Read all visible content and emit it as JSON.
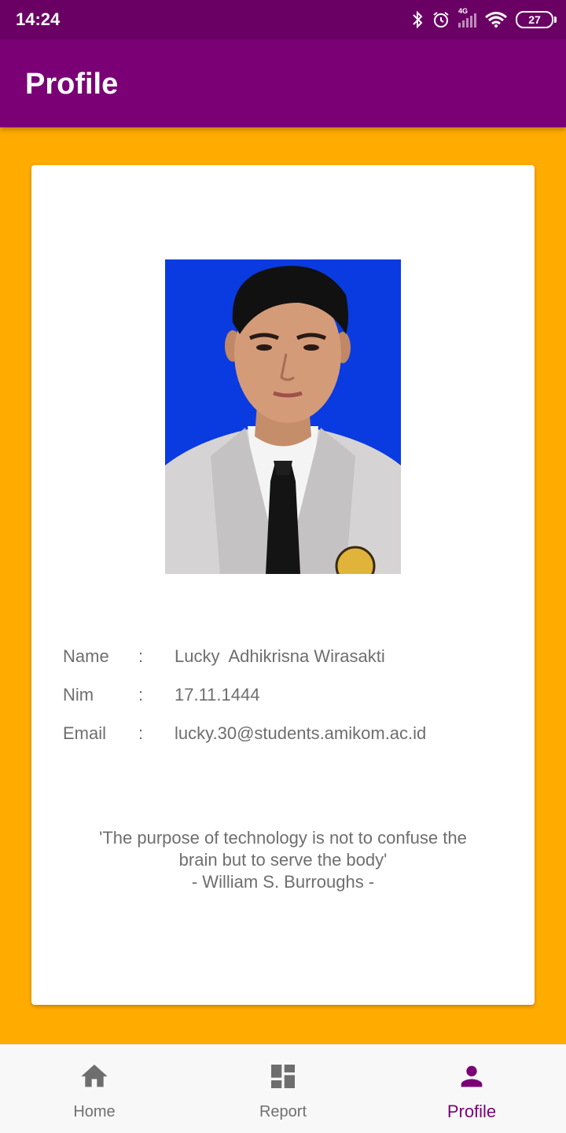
{
  "status_bar": {
    "time": "14:24",
    "network": "4G",
    "battery": "27"
  },
  "app_bar": {
    "title": "Profile"
  },
  "profile": {
    "fields": [
      {
        "label": "Name",
        "separator": ":",
        "value": "Lucky  Adhikrisna Wirasakti"
      },
      {
        "label": "Nim",
        "separator": ":",
        "value": "17.11.1444"
      },
      {
        "label": "Email",
        "separator": ":",
        "value": "lucky.30@students.amikom.ac.id"
      }
    ],
    "quote": {
      "line1": "'The purpose of technology is not to confuse the",
      "line2": "brain but to serve the body'",
      "author": "- William S. Burroughs -"
    }
  },
  "bottom_nav": {
    "items": [
      {
        "label": "Home",
        "icon": "home-icon"
      },
      {
        "label": "Report",
        "icon": "dashboard-icon"
      },
      {
        "label": "Profile",
        "icon": "person-icon"
      }
    ],
    "active_index": 2,
    "active_color": "#7B0076",
    "inactive_color": "#707070"
  },
  "colors": {
    "status_bar": "#6A0064",
    "app_bar": "#7B0076",
    "background": "#FFAB00",
    "photo_background": "#0A3BE0"
  }
}
